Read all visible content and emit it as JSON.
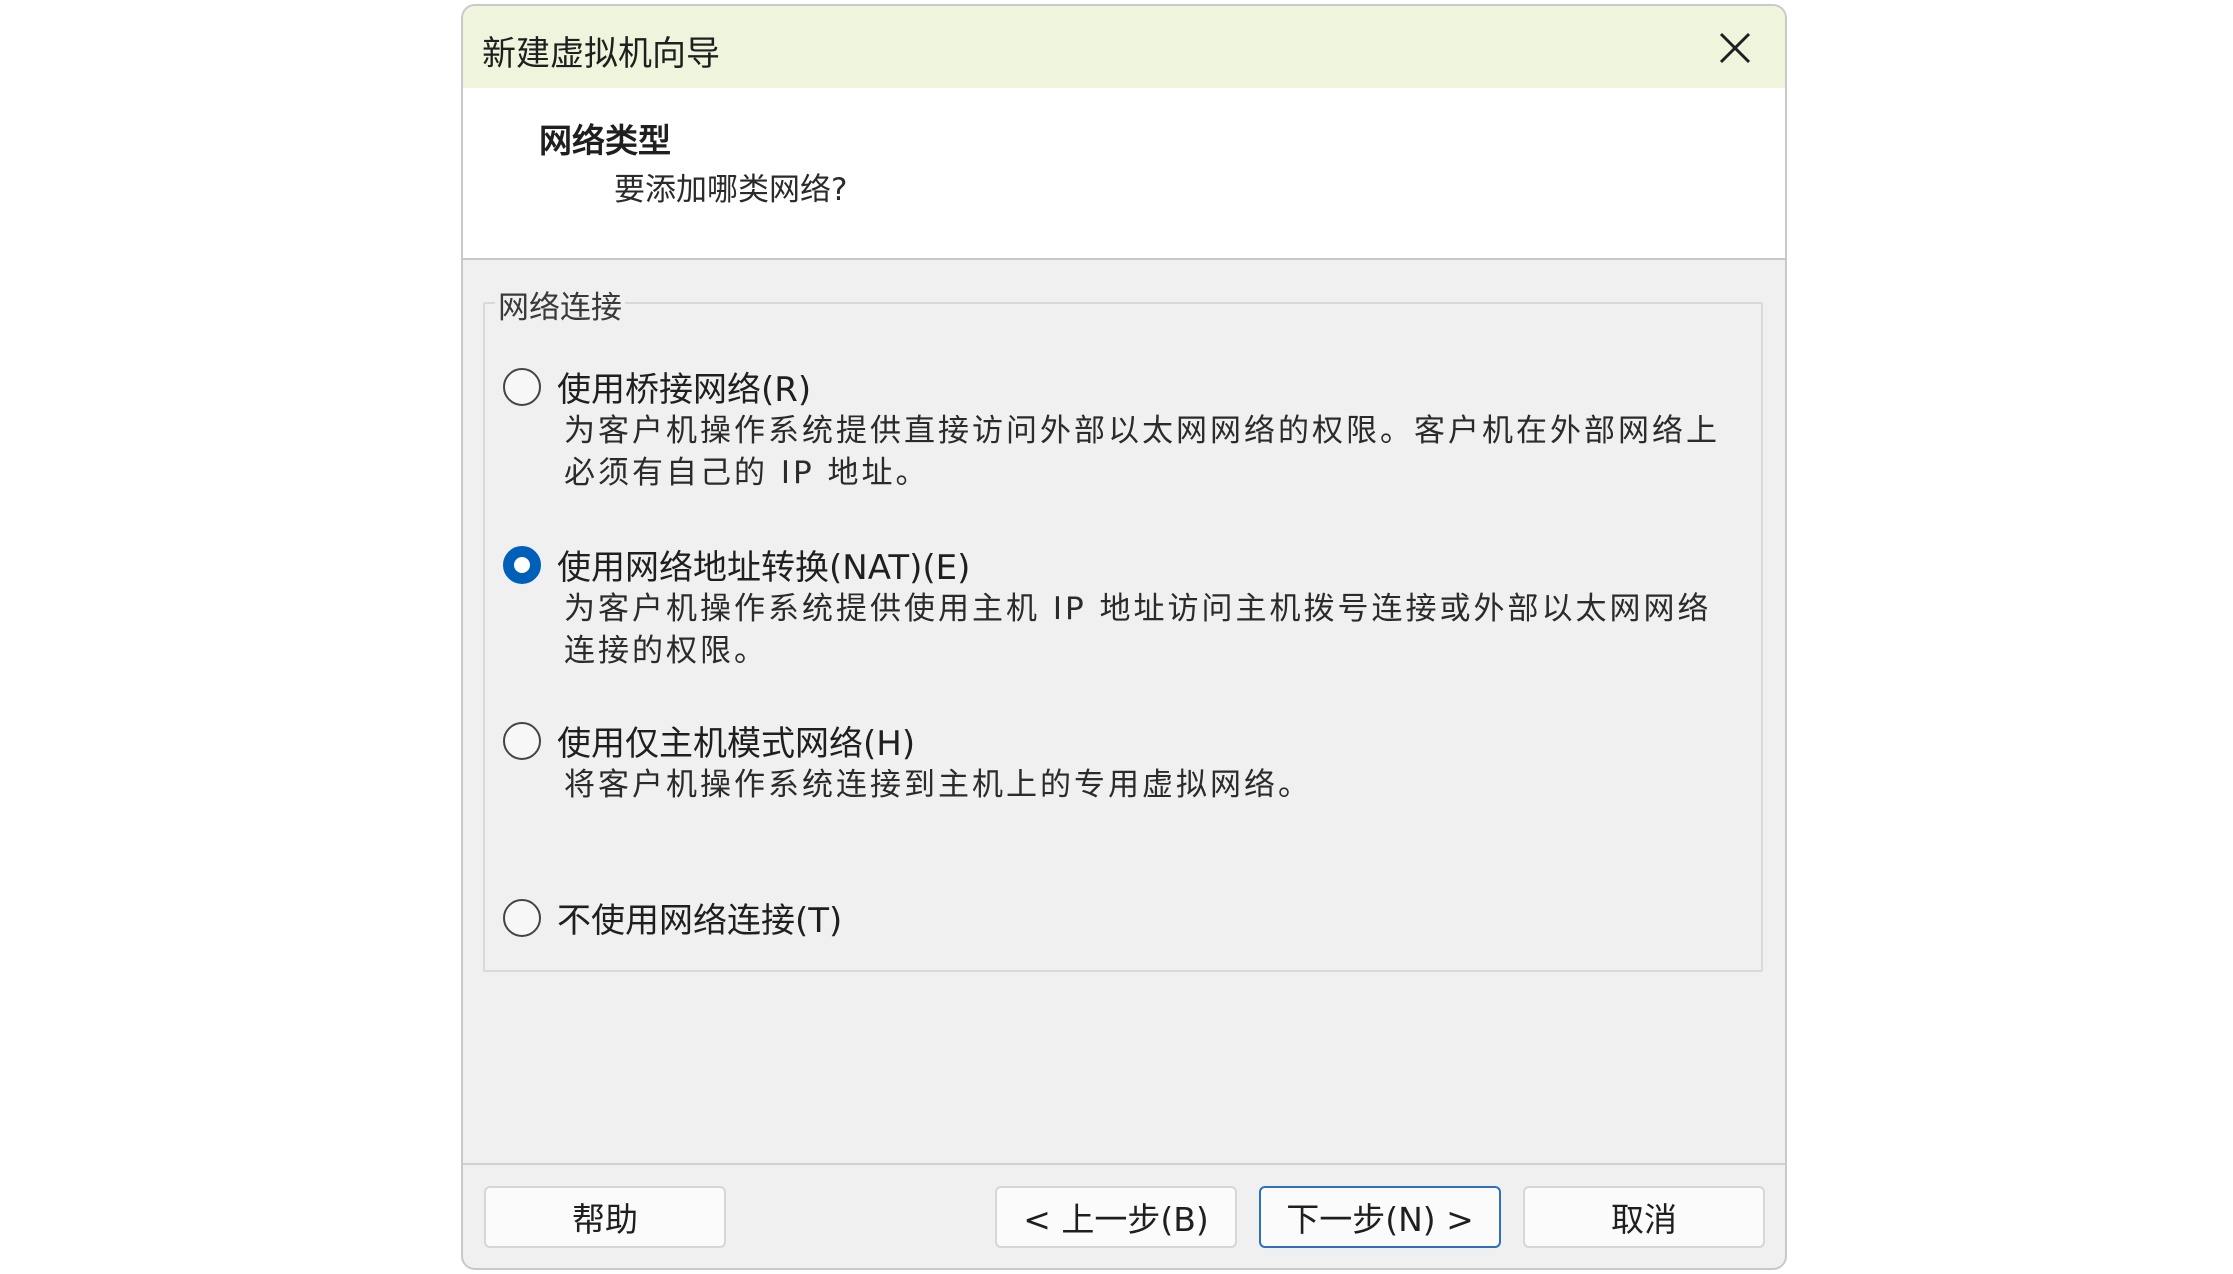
{
  "window": {
    "title": "新建虚拟机向导"
  },
  "header": {
    "title": "网络类型",
    "subtitle": "要添加哪类网络?"
  },
  "group": {
    "label": "网络连接"
  },
  "options": [
    {
      "label": "使用桥接网络(R)",
      "desc": "为客户机操作系统提供直接访问外部以太网网络的权限。客户机在外部网络上必须有自己的 IP 地址。",
      "checked": false
    },
    {
      "label": "使用网络地址转换(NAT)(E)",
      "desc": "为客户机操作系统提供使用主机 IP 地址访问主机拨号连接或外部以太网网络连接的权限。",
      "checked": true
    },
    {
      "label": "使用仅主机模式网络(H)",
      "desc": "将客户机操作系统连接到主机上的专用虚拟网络。",
      "checked": false
    },
    {
      "label": "不使用网络连接(T)",
      "desc": "",
      "checked": false
    }
  ],
  "buttons": {
    "help": "帮助",
    "back": "< 上一步(B)",
    "next": "下一步(N) >",
    "cancel": "取消"
  },
  "colors": {
    "accent": "#005fb8",
    "titlebar": "#eef5dc"
  }
}
